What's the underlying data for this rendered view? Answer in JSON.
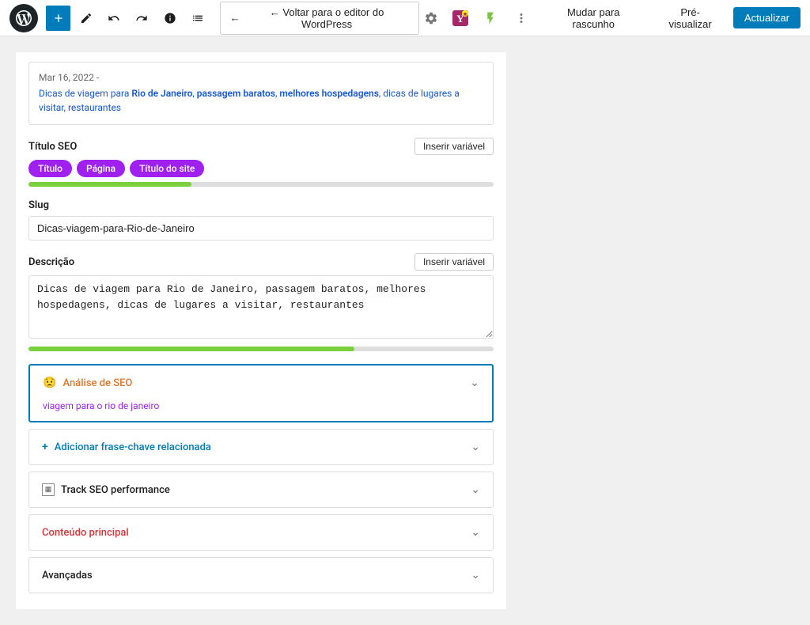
{
  "topbar": {
    "back_label": "← Voltar para o editor do WordPress",
    "mudar_label": "Mudar para rascunho",
    "preview_label": "Pré-visualizar",
    "publish_label": "Actualizar"
  },
  "snippet": {
    "date": "Mar 16, 2022 -",
    "text": "Dicas de viagem para Rio de Janeiro, passagem baratos, melhores hospedagens, dicas de lugares a visitar, restaurantes"
  },
  "seo_title": {
    "label": "Título SEO",
    "insert_var": "Inserir variável",
    "pills": [
      "Título",
      "Página",
      "Título do site"
    ],
    "progress_width": "35"
  },
  "slug": {
    "label": "Slug",
    "value": "Dicas-viagem-para-Rio-de-Janeiro"
  },
  "description": {
    "label": "Descrição",
    "insert_var": "Inserir variável",
    "value": "Dicas de viagem para Rio de Janeiro, passagem baratos, melhores hospedagens, dicas de lugares a visitar, restaurantes",
    "progress_width": "70"
  },
  "seo_analysis": {
    "label": "Análise de SEO",
    "subtitle": "viagem para o rio de janeiro"
  },
  "related_keyword": {
    "label": "Adicionar frase-chave relacionada"
  },
  "track_seo": {
    "label": "Track SEO performance"
  },
  "conteudo": {
    "label": "Conteúdo principal"
  },
  "avancadas": {
    "label": "Avançadas"
  }
}
